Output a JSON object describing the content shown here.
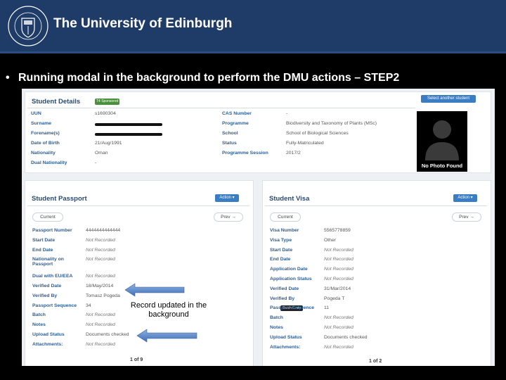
{
  "banner": {
    "title": "The University of Edinburgh",
    "crest_text": "THE UNIVERSITY OF EDINBURGH"
  },
  "bullet": {
    "marker": "•",
    "text": "Running modal in the background to perform the DMU actions – STEP2"
  },
  "details": {
    "title": "Student Details",
    "tag": "T4 Sponsored",
    "select_button": "Select another student",
    "left_rows": [
      {
        "label": "UUN",
        "value": "s1690304"
      },
      {
        "label": "Surname",
        "value": ""
      },
      {
        "label": "Forename(s)",
        "value": ""
      },
      {
        "label": "Date of Birth",
        "value": "21/Aug/1991"
      },
      {
        "label": "Nationality",
        "value": "Oman"
      },
      {
        "label": "Dual Nationality",
        "value": "-"
      }
    ],
    "right_rows": [
      {
        "label": "CAS Number",
        "value": "-"
      },
      {
        "label": "Programme",
        "value": "Biodiversity and Taxonomy of Plants (MSc)"
      },
      {
        "label": "School",
        "value": "School of Biological Sciences"
      },
      {
        "label": "Status",
        "value": "Fully-Matriculated"
      },
      {
        "label": "Programme Session",
        "value": "2017/2"
      }
    ],
    "photo_label": "No Photo Found"
  },
  "passport": {
    "title": "Student Passport",
    "action_button": "Action ▾",
    "current": "Current",
    "prev": "Prev →",
    "rows": [
      {
        "label": "Passport Number",
        "value": "4444444444444"
      },
      {
        "label": "Start Date",
        "value": "Not Recorded"
      },
      {
        "label": "End Date",
        "value": "Not Recorded"
      },
      {
        "label": "Nationality on Passport",
        "value": "Not Recorded"
      },
      {
        "label": "Dual with EU/EEA",
        "value": "Not Recorded"
      },
      {
        "label": "Verified Date",
        "value": "18/May/2014"
      },
      {
        "label": "Verified By",
        "value": "Tomasz Pogeda"
      },
      {
        "label": "Passport Sequence",
        "value": "34"
      },
      {
        "label": "Batch",
        "value": "Not Recorded"
      },
      {
        "label": "Notes",
        "value": "Not Recorded"
      },
      {
        "label": "Upload Status",
        "value": "Documents checked"
      },
      {
        "label": "Attachments:",
        "value": "Not Recorded"
      }
    ],
    "pager": "1 of 9"
  },
  "visa": {
    "title": "Student Visa",
    "action_button": "Action ▾",
    "current": "Current",
    "prev": "Prev →",
    "tooltip": "Batch Code",
    "rows": [
      {
        "label": "Visa Number",
        "value": "5565778859"
      },
      {
        "label": "Visa Type",
        "value": "Other"
      },
      {
        "label": "Start Date",
        "value": "Not Recorded"
      },
      {
        "label": "End Date",
        "value": "Not Recorded"
      },
      {
        "label": "Application Date",
        "value": "Not Recorded"
      },
      {
        "label": "Application Status",
        "value": "Not Recorded"
      },
      {
        "label": "Verified Date",
        "value": "31/Mar/2014"
      },
      {
        "label": "Verified By",
        "value": "Pogeda T"
      },
      {
        "label": "Passport Sequence",
        "value": "11"
      },
      {
        "label": "Batch",
        "value": "Not Recorded"
      },
      {
        "label": "Notes",
        "value": "Not Recorded"
      },
      {
        "label": "Upload Status",
        "value": "Documents checked"
      },
      {
        "label": "Attachments:",
        "value": "Not Recorded"
      }
    ],
    "pager": "1 of 2"
  },
  "callout": {
    "text": "Record updated in the background"
  },
  "colors": {
    "banner": "#1f3b68",
    "arrow": "#4a7fc1",
    "link": "#2e5d92"
  }
}
